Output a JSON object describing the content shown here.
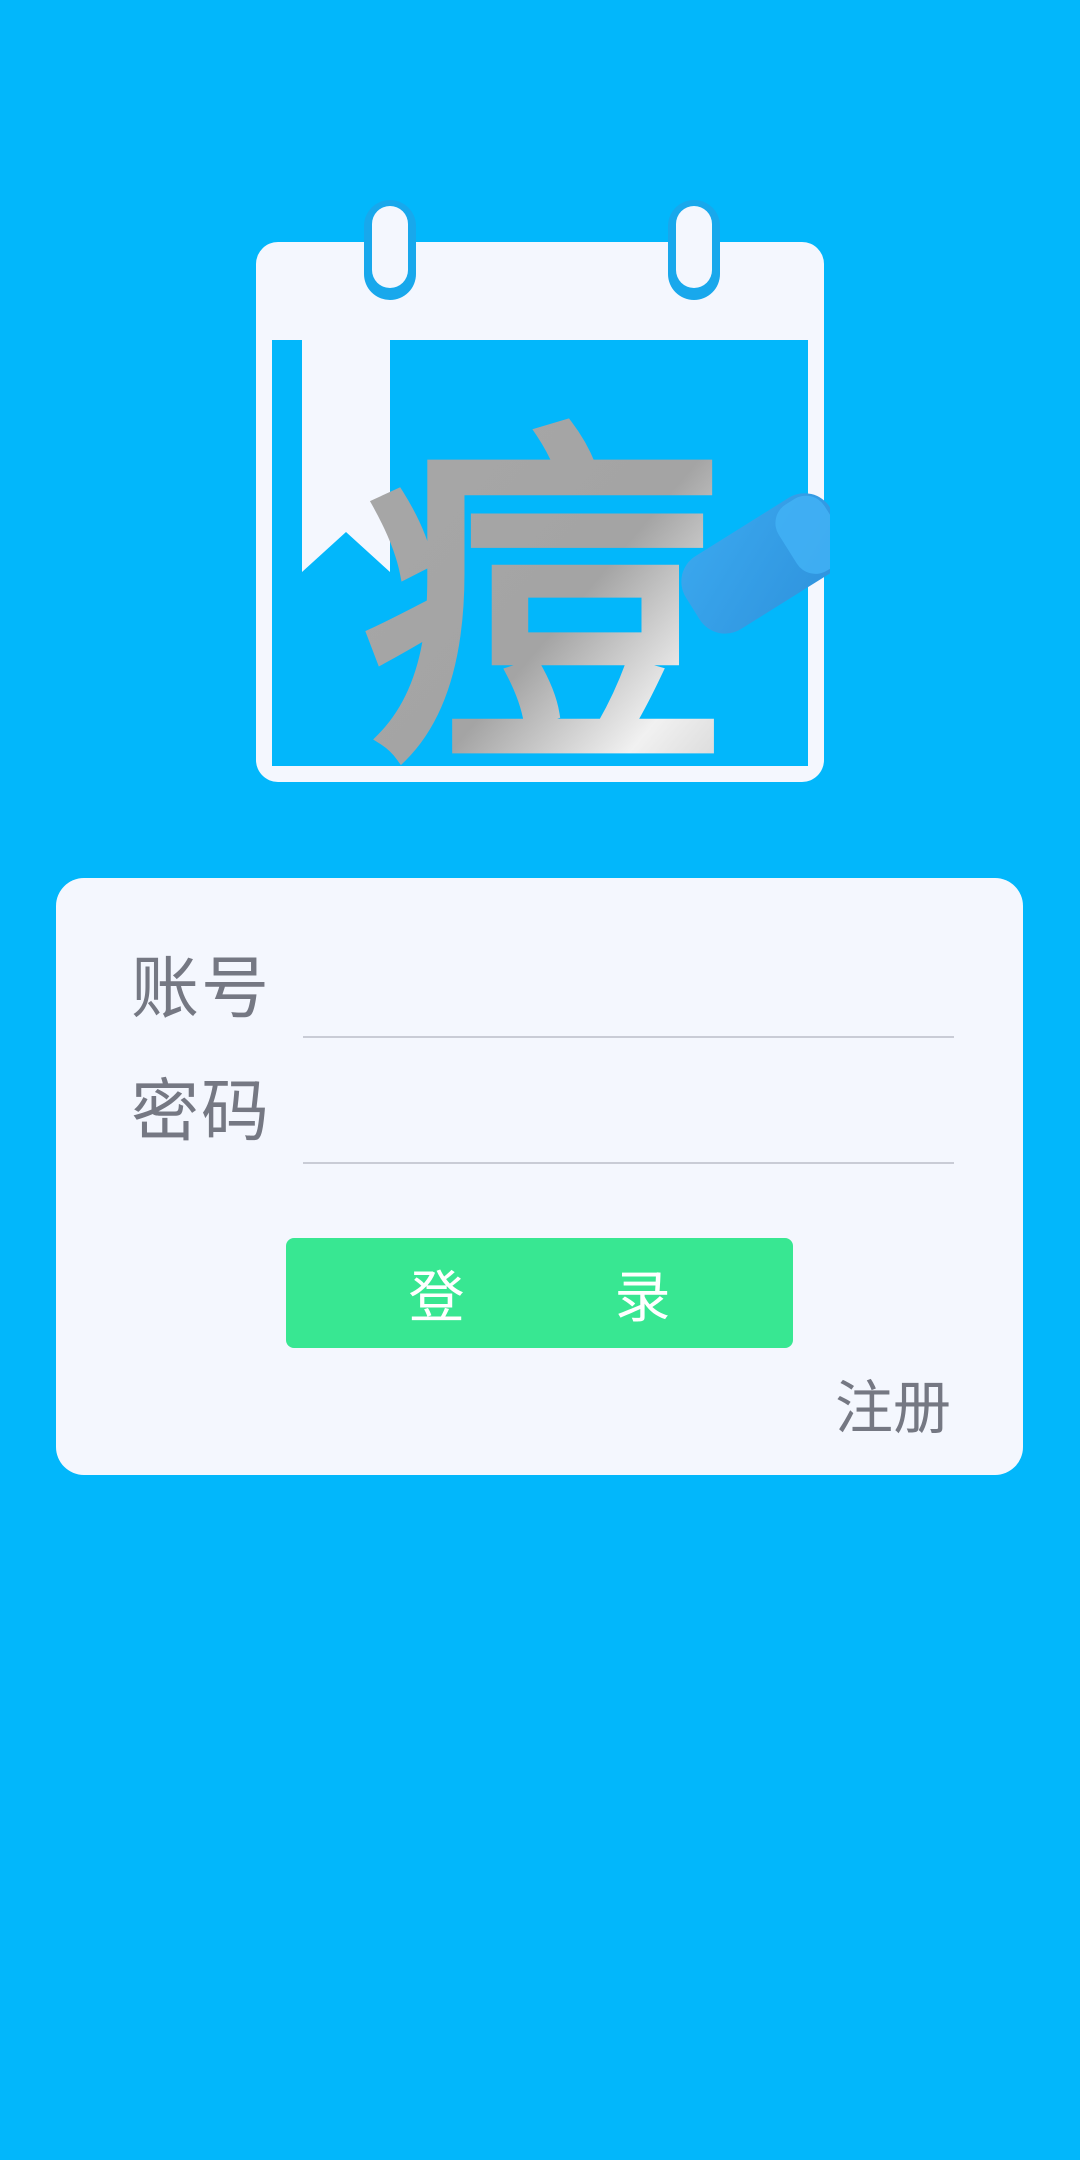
{
  "logo": {
    "glyph": "痘",
    "icon": "calendar-icon"
  },
  "login_form": {
    "account_label": "账号",
    "account_value": "",
    "password_label": "密码",
    "password_value": "",
    "login_button_chars": [
      "登",
      "录"
    ],
    "register_link": "注册"
  },
  "colors": {
    "background": "#02b7fb",
    "card": "#f4f7fe",
    "button": "#38e792",
    "label": "#757883"
  }
}
